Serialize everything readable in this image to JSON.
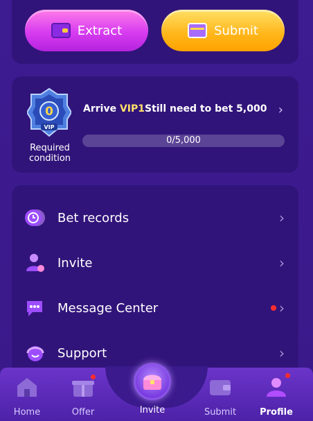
{
  "actions": {
    "extract_label": "Extract",
    "submit_label": "Submit"
  },
  "vip": {
    "badge_level": "0",
    "badge_tag": "VIP",
    "required_condition": "Required condition",
    "arrive_prefix": "Arrive ",
    "arrive_level": "VIP1",
    "arrive_middle": "Still need to bet ",
    "arrive_amount": "5,000",
    "progress_text": "0/5,000",
    "progress_fraction": 0
  },
  "menu": {
    "items": [
      {
        "label": "Bet records",
        "icon": "bet-records-icon"
      },
      {
        "label": "Invite",
        "icon": "invite-user-icon"
      },
      {
        "label": "Message Center",
        "icon": "message-icon",
        "badge": true
      },
      {
        "label": "Support",
        "icon": "support-headset-icon"
      }
    ]
  },
  "nav": {
    "items": [
      {
        "label": "Home",
        "icon": "home-icon"
      },
      {
        "label": "Offer",
        "icon": "gift-icon",
        "dot": true
      },
      {
        "label": "Invite",
        "icon": "treasure-chest-icon",
        "center": true
      },
      {
        "label": "Submit",
        "icon": "wallet-icon"
      },
      {
        "label": "Profile",
        "icon": "profile-icon",
        "dot": true,
        "active": true
      }
    ]
  },
  "colors": {
    "background": "#3a1a8c",
    "card": "#31147a",
    "accent_yellow": "#ffe16b",
    "notification_red": "#ff2d2d"
  }
}
